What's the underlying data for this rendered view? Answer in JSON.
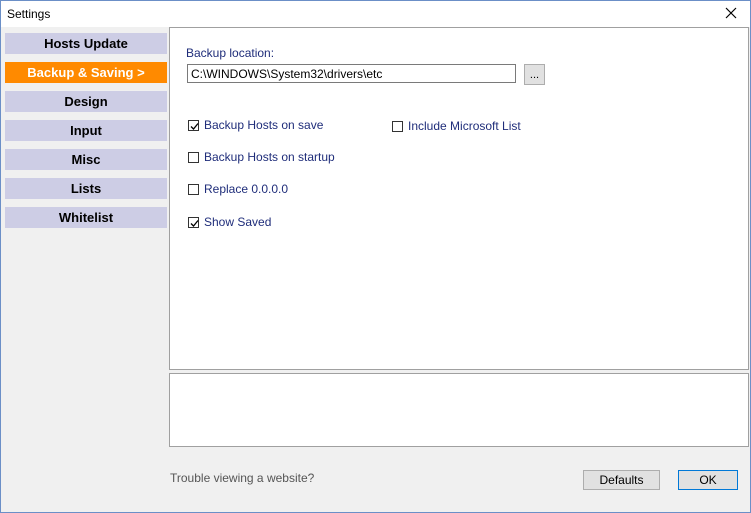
{
  "window": {
    "title": "Settings"
  },
  "nav": {
    "items": [
      {
        "label": "Hosts Update",
        "active": false
      },
      {
        "label": "Backup & Saving  >",
        "active": true
      },
      {
        "label": "Design",
        "active": false
      },
      {
        "label": "Input",
        "active": false
      },
      {
        "label": "Misc",
        "active": false
      },
      {
        "label": "Lists",
        "active": false
      },
      {
        "label": "Whitelist",
        "active": false
      }
    ]
  },
  "backup": {
    "location_label": "Backup location:",
    "location_value": "C:\\WINDOWS\\System32\\drivers\\etc",
    "browse_label": "...",
    "options": [
      {
        "label": "Backup Hosts on save",
        "checked": true
      },
      {
        "label": "Include Microsoft List",
        "checked": false
      },
      {
        "label": "Backup Hosts on startup",
        "checked": false
      },
      {
        "label": "Replace 0.0.0.0",
        "checked": false
      },
      {
        "label": "Show Saved",
        "checked": true
      }
    ]
  },
  "footer": {
    "help_link": "Trouble viewing a website?",
    "defaults_label": "Defaults",
    "ok_label": "OK"
  },
  "colors": {
    "accent": "#ff8a00",
    "nav_bg": "#cdcde5",
    "label_blue": "#1f2d7a"
  }
}
